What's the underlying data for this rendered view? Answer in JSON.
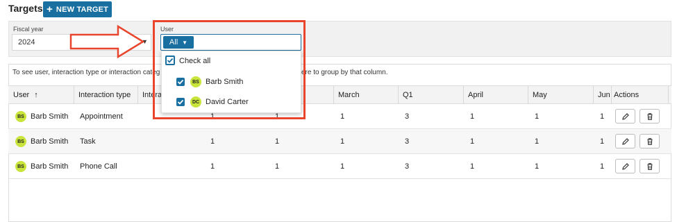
{
  "header": {
    "title": "Targets",
    "new_button": "NEW TARGET"
  },
  "filters": {
    "fiscal_year_label": "Fiscal year",
    "fiscal_year_value": "2024",
    "user_label": "User",
    "user_chip": "All"
  },
  "dropdown": {
    "check_all": "Check all",
    "options": [
      {
        "initials": "BS",
        "name": "Barb Smith"
      },
      {
        "initials": "DC",
        "name": "David Carter"
      }
    ]
  },
  "hint": {
    "left": "To see user, interaction type or interaction categ",
    "right": "ere to group by that column."
  },
  "table": {
    "columns": {
      "user": "User",
      "sort_icon": "↑",
      "interaction_type": "Interaction type",
      "interaction_partial": "Intera",
      "march": "March",
      "q1": "Q1",
      "april": "April",
      "may": "May",
      "june_partial": "Jun",
      "actions": "Actions"
    },
    "rows": [
      {
        "initials": "BS",
        "user": "Barb Smith",
        "type": "Appointment",
        "c1": "1",
        "c2": "1",
        "march": "1",
        "q1": "3",
        "april": "1",
        "may": "1",
        "jun": "1"
      },
      {
        "initials": "BS",
        "user": "Barb Smith",
        "type": "Task",
        "c1": "1",
        "c2": "1",
        "march": "1",
        "q1": "3",
        "april": "1",
        "may": "1",
        "jun": "1"
      },
      {
        "initials": "BS",
        "user": "Barb Smith",
        "type": "Phone Call",
        "c1": "1",
        "c2": "1",
        "march": "1",
        "q1": "3",
        "april": "1",
        "may": "1",
        "jun": "1"
      }
    ]
  },
  "colors": {
    "accent": "#1a6fa1",
    "highlight": "#e8452c",
    "avatar": "#c9e43a"
  },
  "icons": {
    "plus": "plus-icon",
    "caret": "caret-down-icon",
    "check": "check-icon",
    "edit": "pencil-icon",
    "delete": "trash-icon",
    "sort": "sort-ascending-icon"
  }
}
